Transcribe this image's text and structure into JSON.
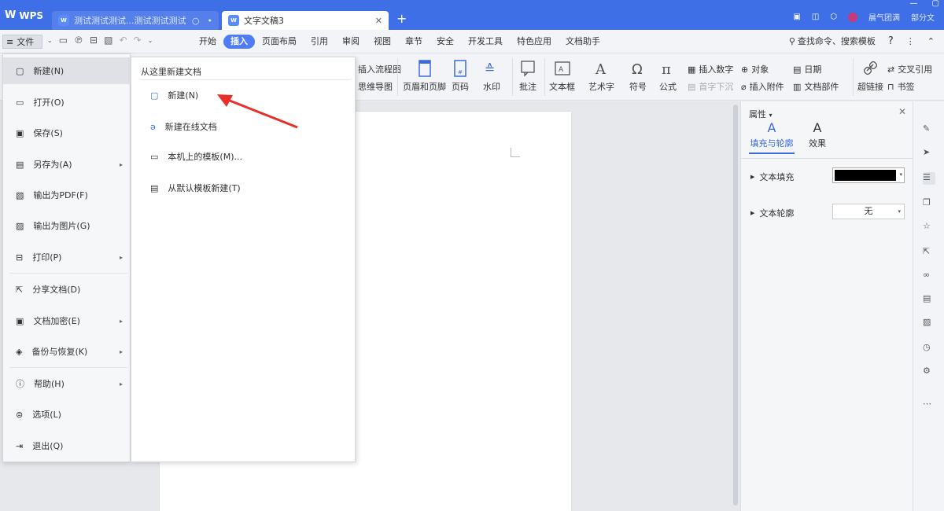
{
  "title_bar": {
    "app_name": "WPS",
    "tabs": [
      {
        "label": "测试测试测试...测试测试测试",
        "badge": "W"
      },
      {
        "label": "文字文稿3",
        "badge": "W"
      }
    ],
    "user_name": "晨气团满",
    "right_label": "部分文"
  },
  "menubar": {
    "file_label": "文件",
    "items": [
      "开始",
      "插入",
      "页面布局",
      "引用",
      "审阅",
      "视图",
      "章节",
      "安全",
      "开发工具",
      "特色应用",
      "文档助手"
    ],
    "active_item": "插入",
    "search_label": "查找命令、搜索模板"
  },
  "ribbon": {
    "partial_top": "插入流程图",
    "partial_bottom": "思维导图",
    "big_buttons": [
      "页眉和页脚",
      "页码",
      "水印",
      "批注",
      "文本框",
      "艺术字",
      "符号",
      "公式"
    ],
    "small_buttons": [
      "插入数字",
      "对象",
      "日期",
      "首字下沉",
      "插入附件",
      "文档部件"
    ],
    "end_buttons": [
      "超链接",
      "交叉引用",
      "书签"
    ]
  },
  "file_menu": {
    "items": [
      {
        "label": "新建(N)",
        "has_sub": false,
        "active": true
      },
      {
        "label": "打开(O)",
        "has_sub": false
      },
      {
        "label": "保存(S)",
        "has_sub": false
      },
      {
        "label": "另存为(A)",
        "has_sub": true
      },
      {
        "label": "输出为PDF(F)",
        "has_sub": false
      },
      {
        "label": "输出为图片(G)",
        "has_sub": false
      },
      {
        "label": "打印(P)",
        "has_sub": true
      },
      {
        "label": "分享文档(D)",
        "has_sub": false
      },
      {
        "label": "文档加密(E)",
        "has_sub": true
      },
      {
        "label": "备份与恢复(K)",
        "has_sub": true
      },
      {
        "label": "帮助(H)",
        "has_sub": true
      },
      {
        "label": "选项(L)",
        "has_sub": false
      },
      {
        "label": "退出(Q)",
        "has_sub": false
      }
    ]
  },
  "new_submenu": {
    "title": "从这里新建文档",
    "items": [
      {
        "label": "新建(N)"
      },
      {
        "label": "新建在线文档"
      },
      {
        "label": "本机上的模板(M)..."
      },
      {
        "label": "从默认模板新建(T)"
      }
    ]
  },
  "properties_panel": {
    "title": "属性",
    "tabs": [
      "填充与轮廓",
      "效果"
    ],
    "active_tab": "填充与轮廓",
    "rows": [
      {
        "label": "文本填充"
      },
      {
        "label": "文本轮廓",
        "value": "无"
      }
    ],
    "fill_color": "#000000"
  },
  "colors": {
    "title_bar": "#3f6fe6",
    "active_tab": "#4d7cf5",
    "arrow": "#e8302b"
  }
}
